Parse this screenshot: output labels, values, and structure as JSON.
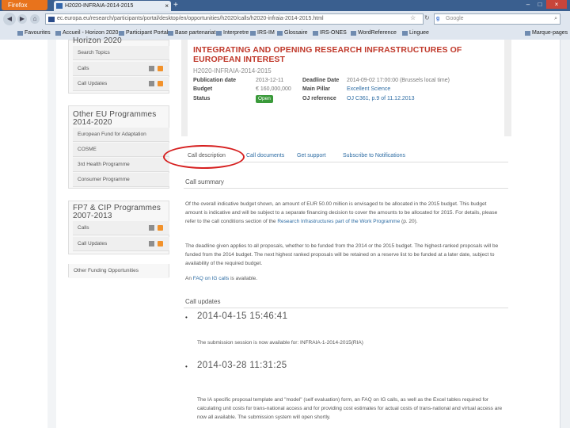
{
  "browser": {
    "app_button": "Firefox",
    "tab_title": "H2020-INFRAIA-2014-2015",
    "url": "ec.europa.eu/research/participants/portal/desktop/en/opportunities/h2020/calls/h2020-infraia-2014-2015.html",
    "search_placeholder": "Google",
    "search_engine_glyph": "g",
    "bookmarks": [
      "Favourites",
      "Accueil - Horizon 2020",
      "Participant Portal",
      "Base partenariat",
      "Interpretre",
      "IRS-IM",
      "Glossaire",
      "IRS-ONES",
      "WordReference",
      "Linguee",
      "Marque-pages"
    ]
  },
  "sidebar": {
    "h2020_heading": "Horizon 2020",
    "h2020_items": [
      "Search Topics",
      "Calls",
      "Call Updates"
    ],
    "other_heading": "Other EU Programmes 2014-2020",
    "other_items": [
      "European Fund for Adaptation",
      "COSME",
      "3rd Health Programme",
      "Consumer Programme"
    ],
    "fp7_heading": "FP7 & CIP Programmes 2007-2013",
    "fp7_items": [
      "Calls",
      "Call Updates"
    ],
    "other_funding": "Other Funding Opportunities"
  },
  "call": {
    "title": "Integrating and opening research infrastructures of European interest",
    "identifier": "H2020-INFRAIA-2014-2015",
    "publication_date_label": "Publication date",
    "publication_date": "2013-12-11",
    "budget_label": "Budget",
    "budget": "€ 160,000,000",
    "status_label": "Status",
    "status": "Open",
    "deadline_label": "Deadline Date",
    "deadline": "2014-09-02 17:00:00 (Brussels local time)",
    "pillar_label": "Main Pillar",
    "pillar": "Excellent Science",
    "oj_label": "OJ reference",
    "oj": "OJ C361, p.9 of 11.12.2013"
  },
  "tabs": [
    "Call description",
    "Call documents",
    "Get support",
    "Subscribe to Notifications"
  ],
  "summary": {
    "heading": "Call summary",
    "p1": "Of the overall indicative budget shown, an amount of EUR 50.00 million is envisaged to be allocated in the 2015 budget. This budget amount is indicative and will be subject to a separate financing decision to cover the amounts to be allocated for 2015. For details, please refer to the call conditions section of the",
    "p1_link": "Research Infrastructures part of the Work Programme",
    "p1_end": "(p. 20).",
    "p2": "The deadline given applies to all proposals, whether to be funded from the 2014 or the 2015 budget. The highest-ranked proposals will be funded from the 2014 budget. The next highest ranked proposals will be retained on a reserve list to be funded at a later date, subject to availability of the required budget.",
    "p3_start": "An",
    "p3_link": "FAQ on IG calls",
    "p3_end": "is available."
  },
  "updates": {
    "heading": "Call updates",
    "items": [
      {
        "timestamp": "2014-04-15 15:46:41",
        "text": "The submission session is now available for: INFRAIA-1-2014-2015(RIA)"
      },
      {
        "timestamp": "2014-03-28 11:31:25",
        "text": "The IA specific proposal template and \"model\" (self evaluation) form, an FAQ on IG calls, as well as the Excel tables required for calculating unit costs for trans-national access and for providing cost estimates for actual costs of trans-national and virtual access are now all available. The submission system will open shortly."
      }
    ]
  },
  "colors": {
    "title_red": "#c0392b",
    "link_blue": "#2e6da4",
    "status_green": "#3a9a3a",
    "annotation_red": "#d61f1f"
  }
}
